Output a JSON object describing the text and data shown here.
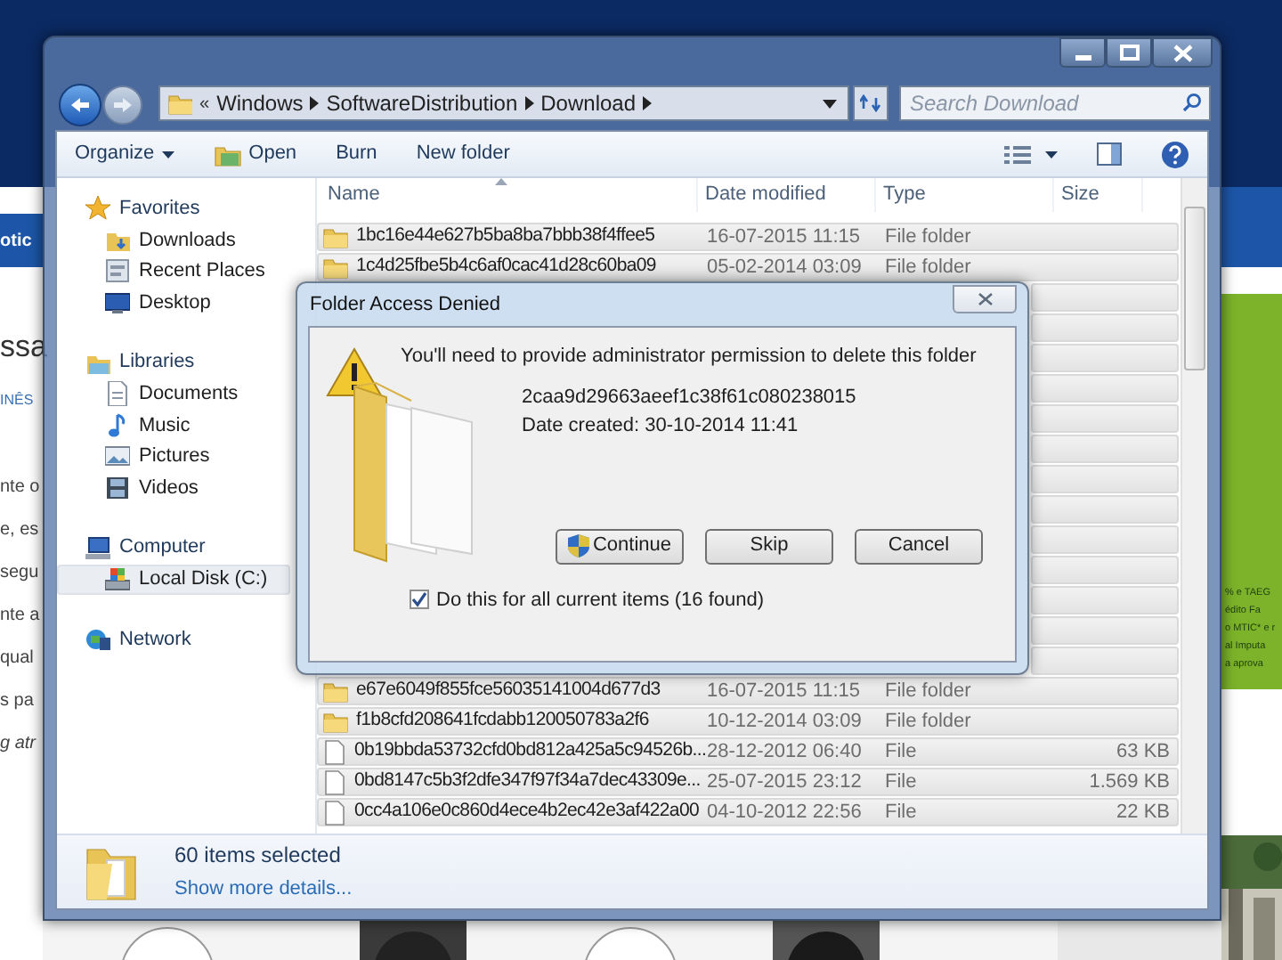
{
  "background_page": {
    "left_fragments": [
      {
        "text": "otic",
        "kind": "band"
      },
      {
        "text": "ssa",
        "kind": "heading"
      },
      {
        "text": "INÊS",
        "kind": "byline"
      },
      {
        "text": "nte o",
        "kind": "line"
      },
      {
        "text": "e, es",
        "kind": "line"
      },
      {
        "text": "segu",
        "kind": "line"
      },
      {
        "text": "nte a",
        "kind": "line"
      },
      {
        "text": "qual",
        "kind": "line"
      },
      {
        "text": "s pa",
        "kind": "line"
      },
      {
        "text": "g atr",
        "kind": "italic"
      }
    ],
    "right_fragments": [
      "% e TAEG",
      "édito Fa",
      "o MTIC* e r",
      "al Imputa",
      "a aprova"
    ]
  },
  "window": {
    "address": {
      "overflow": "«",
      "path": [
        "Windows",
        "SoftwareDistribution",
        "Download"
      ]
    },
    "search": {
      "placeholder": "Search Download"
    },
    "toolbar": [
      {
        "label": "Organize",
        "kind": "menu"
      },
      {
        "label": "Open",
        "kind": "open"
      },
      {
        "label": "Burn",
        "kind": "plain"
      },
      {
        "label": "New folder",
        "kind": "plain"
      }
    ],
    "nav": [
      {
        "label": "Favorites",
        "selected": false,
        "children": [
          {
            "label": "Downloads",
            "selected": false
          },
          {
            "label": "Recent Places",
            "selected": false
          },
          {
            "label": "Desktop",
            "selected": false
          }
        ]
      },
      {
        "label": "Libraries",
        "selected": false,
        "children": [
          {
            "label": "Documents",
            "selected": false
          },
          {
            "label": "Music",
            "selected": false
          },
          {
            "label": "Pictures",
            "selected": false
          },
          {
            "label": "Videos",
            "selected": false
          }
        ]
      },
      {
        "label": "Computer",
        "selected": false,
        "children": [
          {
            "label": "Local Disk (C:)",
            "selected": true
          }
        ]
      },
      {
        "label": "Network",
        "selected": false
      }
    ],
    "columns": [
      "Name",
      "Date modified",
      "Type",
      "Size"
    ],
    "rows_top": [
      {
        "kind": "folder",
        "name": "1bc16e44e627b5ba8ba7bbb38f4ffee5",
        "date": "16-07-2015 11:15",
        "type": "File folder",
        "selected": true
      },
      {
        "kind": "folder",
        "name": "1c4d25fbe5b4c6af0cac41d28c60ba09",
        "date": "05-02-2014 03:09",
        "type": "File folder",
        "selected": true
      }
    ],
    "rows_bottom": [
      {
        "kind": "folder",
        "name": "e67e6049f855fce56035141004d677d3",
        "date": "16-07-2015 11:15",
        "type": "File folder",
        "selected": true
      },
      {
        "kind": "folder",
        "name": "f1b8cfd208641fcdabb120050783a2f6",
        "date": "10-12-2014 03:09",
        "type": "File folder",
        "selected": true
      },
      {
        "kind": "file",
        "name": "0b19bbda53732cfd0bd812a425a5c94526b...",
        "date": "28-12-2012 06:40",
        "type": "File",
        "size": "63 KB",
        "selected": true
      },
      {
        "kind": "file",
        "name": "0bd8147c5b3f2dfe347f97f34a7dec43309e...",
        "date": "25-07-2015 23:12",
        "type": "File",
        "size": "1.569 KB",
        "selected": true
      },
      {
        "kind": "file",
        "name": "0cc4a106e0c860d4ece4b2ec42e3af422a00",
        "date": "04-10-2012 22:56",
        "type": "File",
        "size": "22 KB",
        "selected": true
      }
    ],
    "details": {
      "count": "60 items selected",
      "link": "Show more details..."
    }
  },
  "dialog": {
    "title": "Folder Access Denied",
    "message": "You'll need to provide administrator permission to delete this folder",
    "item_name": "2caa9d29663aeef1c38f61c080238015",
    "date_created": "Date created: 30-10-2014 11:41",
    "buttons": [
      {
        "label": "Continue",
        "kind": "shield"
      },
      {
        "label": "Skip",
        "kind": "plain"
      },
      {
        "label": "Cancel",
        "kind": "plain"
      }
    ],
    "checkbox": {
      "label": "Do this for all current items (16 found)",
      "checked": true
    }
  }
}
